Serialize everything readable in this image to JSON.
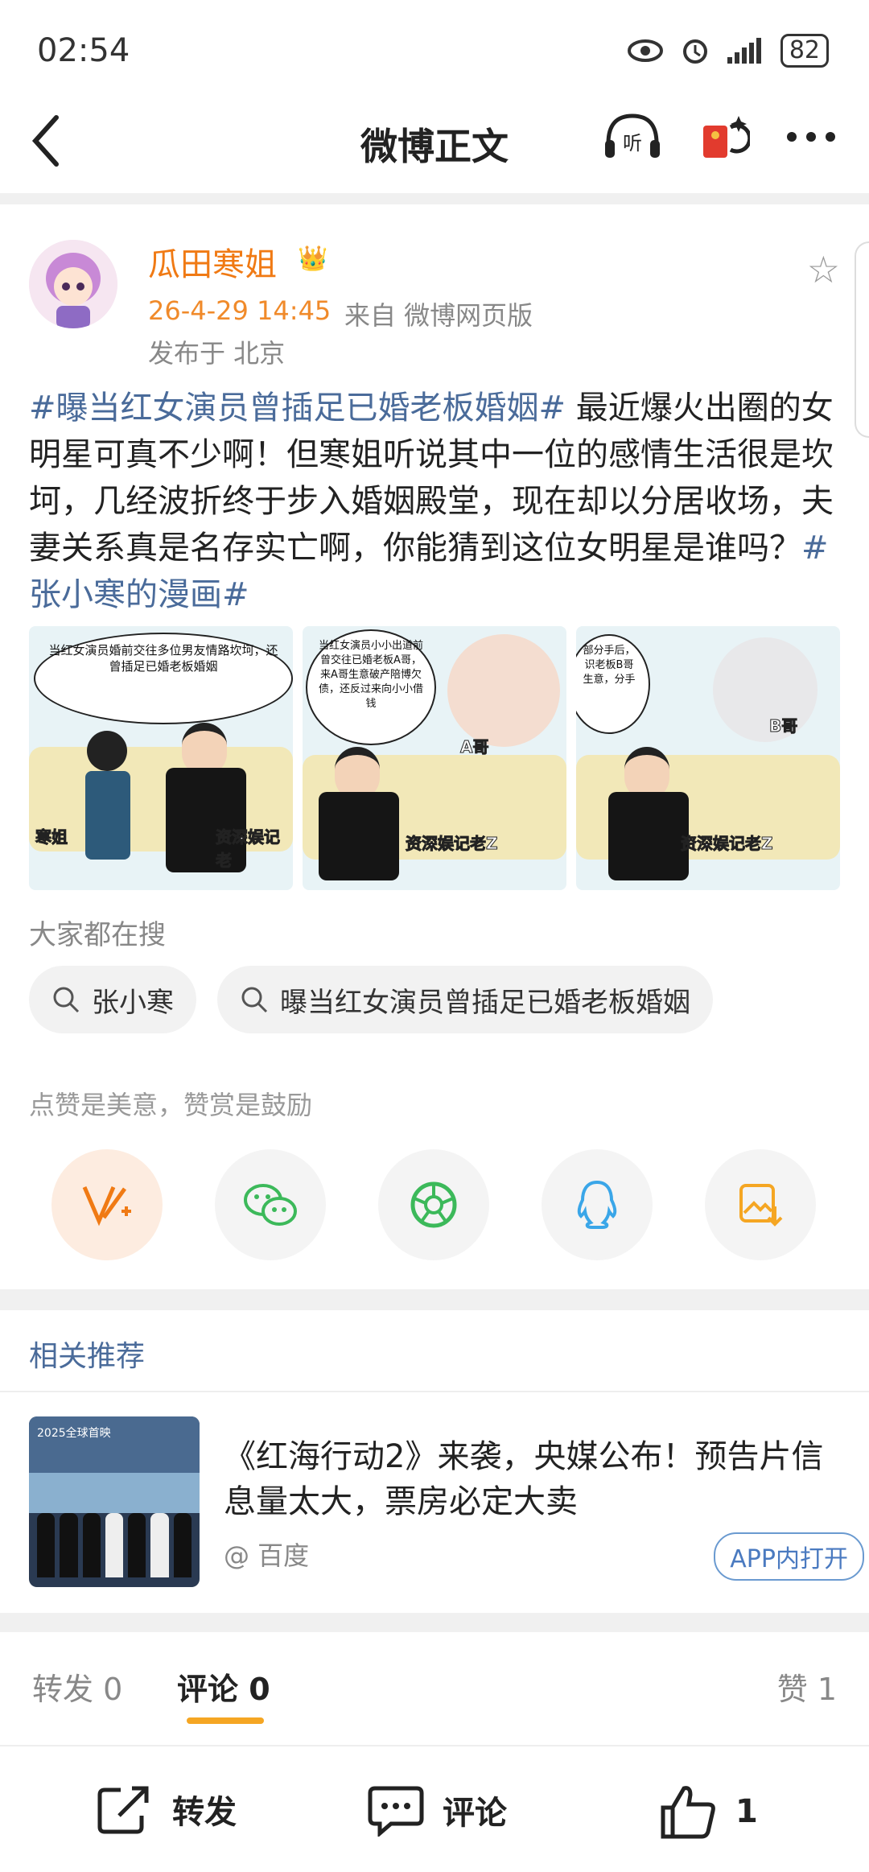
{
  "status_bar": {
    "time": "02:54",
    "battery": "82"
  },
  "header": {
    "title": "微博正文"
  },
  "post": {
    "username": "瓜田寒姐",
    "timestamp": "26-4-29 14:45",
    "source": "来自 微博网页版",
    "location": "发布于 北京",
    "tag1": "#曝当红女演员曾插足已婚老板婚姻#",
    "body": " 最近爆火出圈的女明星可真不少啊！但寒姐听说其中一位的感情生活很是坎坷，几经波折终于步入婚姻殿堂，现在却以分居收场，夫妻关系真是名存实亡啊，你能猜到这位女明星是谁吗？",
    "tag2": "#张小寒的漫画#",
    "images": [
      {
        "bubble": "当红女演员婚前交往多位男友情路坎坷，还曾插足已婚老板婚姻",
        "label_left": "寒姐",
        "label_right": "资深娱记老"
      },
      {
        "bubble": "当红女演员小小出道前曾交往已婚老板A哥，来A哥生意破产陪博欠债，还反过来向小小借钱",
        "label_a": "A哥",
        "label_right": "资深娱记老Z"
      },
      {
        "bubble": "部分手后，识老板B哥 生意，分手",
        "label_b": "B哥",
        "label_right": "资深娱记老Z"
      }
    ]
  },
  "search": {
    "label": "大家都在搜",
    "chips": [
      "张小寒",
      "曝当红女演员曾插足已婚老板婚姻"
    ]
  },
  "like_hint": "点赞是美意，赞赏是鼓励",
  "share_icons": [
    "reward-icon",
    "wechat-icon",
    "moments-icon",
    "qq-icon",
    "save-image-icon"
  ],
  "related": {
    "title": "相关推荐",
    "news_title": "《红海行动2》来袭，央媒公布！预告片信息量太大，票房必定大卖",
    "news_source": "@ 百度",
    "open_app": "APP内打开",
    "thumb_caption": "2025全球首映"
  },
  "tabs": {
    "repost": "转发 0",
    "comment": "评论 0",
    "like": "赞 1"
  },
  "bottom_bar": {
    "repost": "转发",
    "comment": "评论",
    "like_count": "1"
  },
  "colors": {
    "accent_orange": "#f07a14",
    "link_blue": "#4a6b9a",
    "underline": "#f5a623"
  }
}
